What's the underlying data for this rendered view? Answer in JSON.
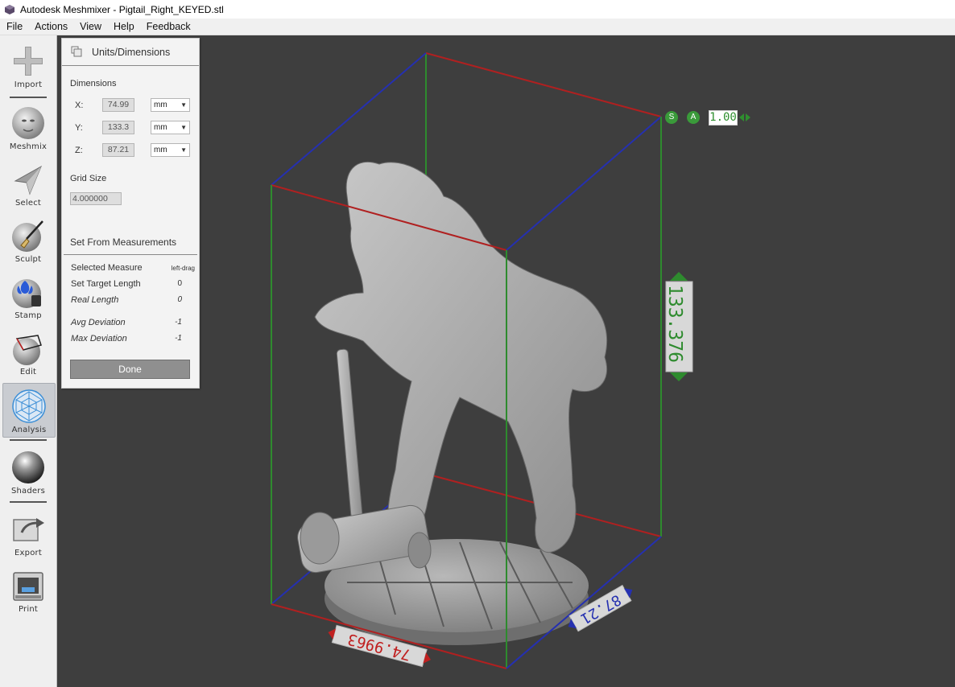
{
  "window": {
    "title": "Autodesk Meshmixer - Pigtail_Right_KEYED.stl"
  },
  "menu": [
    "File",
    "Actions",
    "View",
    "Help",
    "Feedback"
  ],
  "tools": [
    {
      "label": "Import",
      "icon": "plus-icon"
    },
    {
      "label": "Meshmix",
      "icon": "meshmix-icon"
    },
    {
      "label": "Select",
      "icon": "select-arrow-icon"
    },
    {
      "label": "Sculpt",
      "icon": "sculpt-brush-icon"
    },
    {
      "label": "Stamp",
      "icon": "stamp-icon"
    },
    {
      "label": "Edit",
      "icon": "edit-icon"
    },
    {
      "label": "Analysis",
      "icon": "analysis-icon",
      "active": true
    },
    {
      "label": "Shaders",
      "icon": "shaders-icon"
    },
    {
      "label": "Export",
      "icon": "export-icon"
    },
    {
      "label": "Print",
      "icon": "print-icon"
    }
  ],
  "panel": {
    "title": "Units/Dimensions",
    "dimensions_heading": "Dimensions",
    "dims": [
      {
        "axis": "X:",
        "value": "74.99",
        "unit": "mm"
      },
      {
        "axis": "Y:",
        "value": "133.3",
        "unit": "mm"
      },
      {
        "axis": "Z:",
        "value": "87.21",
        "unit": "mm"
      }
    ],
    "grid_size_label": "Grid Size",
    "grid_size_value": "4.000000",
    "set_from_heading": "Set From Measurements",
    "selected_measure_label": "Selected Measure",
    "selected_measure_value": "left-drag",
    "target_length_label": "Set Target Length",
    "target_length_value": "0",
    "real_length_label": "Real Length",
    "real_length_value": "0",
    "avg_dev_label": "Avg Deviation",
    "avg_dev_value": "-1",
    "max_dev_label": "Max Deviation",
    "max_dev_value": "-1",
    "done_label": "Done"
  },
  "viewport": {
    "scale_s": "S",
    "scale_a": "A",
    "scale_value": "1.00",
    "height_label": "133.376",
    "width_label": "74.9963",
    "depth_label": "87.21",
    "colors": {
      "height_axis": "#2e8b2e",
      "width_axis": "#c02020",
      "depth_axis": "#2530b0",
      "background": "#3e3e3e"
    }
  }
}
